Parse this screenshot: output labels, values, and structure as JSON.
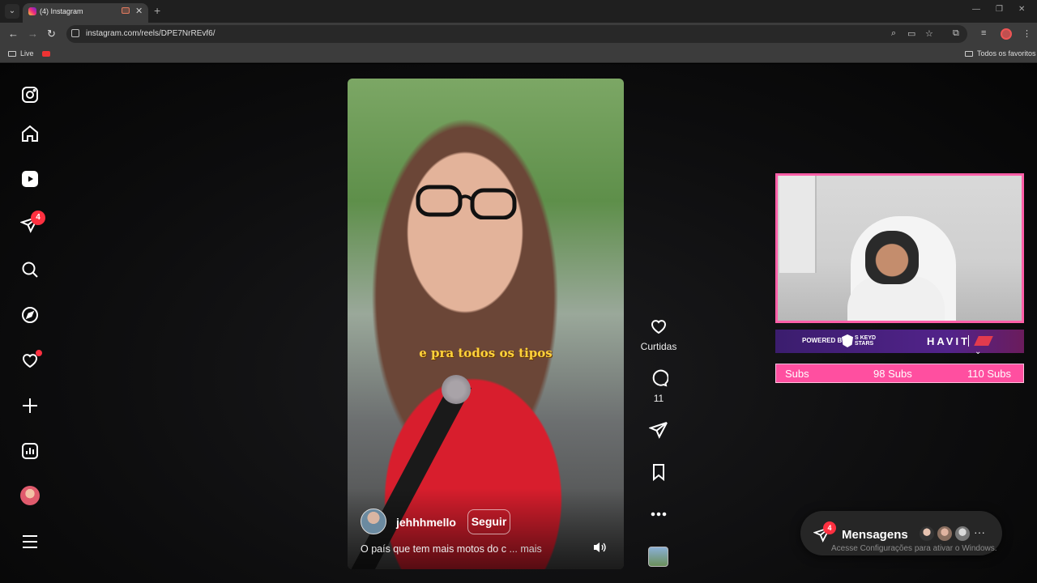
{
  "browser": {
    "tab_title": "(4) Instagram",
    "url": "instagram.com/reels/DPE7NrREvf6/",
    "bookmark_live": "Live",
    "bookmark_all": "Todos os favoritos"
  },
  "sidebar": {
    "notifications_badge": "4"
  },
  "reel": {
    "caption_overlay": "e pra todos os tipos",
    "author": "jehhhmello",
    "follow_label": "Seguir",
    "description": "O país que tem mais motos do c",
    "more_label": "... mais"
  },
  "actions": {
    "likes_label": "Curtidas",
    "comments_count": "11"
  },
  "overlay": {
    "powered_by": "POWERED BY",
    "brand": "S KEYD STARS",
    "sponsor": "HAVIT",
    "subs_label": "Subs",
    "subs_current": "98 Subs",
    "subs_goal": "110 Subs"
  },
  "messages": {
    "label": "Mensagens",
    "badge": "4",
    "windows_notice": "Acesse Configurações para ativar o Windows."
  },
  "colors": {
    "accent_red": "#ff3040",
    "overlay_pink": "#ff4fa0",
    "caption_yellow": "#ffd23a"
  }
}
